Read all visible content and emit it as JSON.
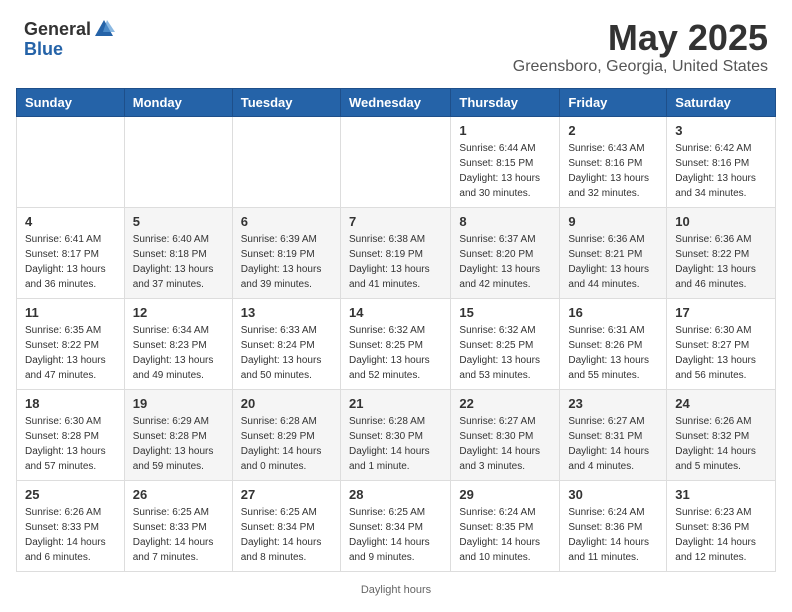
{
  "header": {
    "logo_general": "General",
    "logo_blue": "Blue",
    "title": "May 2025",
    "subtitle": "Greensboro, Georgia, United States"
  },
  "calendar": {
    "days_of_week": [
      "Sunday",
      "Monday",
      "Tuesday",
      "Wednesday",
      "Thursday",
      "Friday",
      "Saturday"
    ],
    "weeks": [
      [
        {
          "day": "",
          "info": ""
        },
        {
          "day": "",
          "info": ""
        },
        {
          "day": "",
          "info": ""
        },
        {
          "day": "",
          "info": ""
        },
        {
          "day": "1",
          "info": "Sunrise: 6:44 AM\nSunset: 8:15 PM\nDaylight: 13 hours and 30 minutes."
        },
        {
          "day": "2",
          "info": "Sunrise: 6:43 AM\nSunset: 8:16 PM\nDaylight: 13 hours and 32 minutes."
        },
        {
          "day": "3",
          "info": "Sunrise: 6:42 AM\nSunset: 8:16 PM\nDaylight: 13 hours and 34 minutes."
        }
      ],
      [
        {
          "day": "4",
          "info": "Sunrise: 6:41 AM\nSunset: 8:17 PM\nDaylight: 13 hours and 36 minutes."
        },
        {
          "day": "5",
          "info": "Sunrise: 6:40 AM\nSunset: 8:18 PM\nDaylight: 13 hours and 37 minutes."
        },
        {
          "day": "6",
          "info": "Sunrise: 6:39 AM\nSunset: 8:19 PM\nDaylight: 13 hours and 39 minutes."
        },
        {
          "day": "7",
          "info": "Sunrise: 6:38 AM\nSunset: 8:19 PM\nDaylight: 13 hours and 41 minutes."
        },
        {
          "day": "8",
          "info": "Sunrise: 6:37 AM\nSunset: 8:20 PM\nDaylight: 13 hours and 42 minutes."
        },
        {
          "day": "9",
          "info": "Sunrise: 6:36 AM\nSunset: 8:21 PM\nDaylight: 13 hours and 44 minutes."
        },
        {
          "day": "10",
          "info": "Sunrise: 6:36 AM\nSunset: 8:22 PM\nDaylight: 13 hours and 46 minutes."
        }
      ],
      [
        {
          "day": "11",
          "info": "Sunrise: 6:35 AM\nSunset: 8:22 PM\nDaylight: 13 hours and 47 minutes."
        },
        {
          "day": "12",
          "info": "Sunrise: 6:34 AM\nSunset: 8:23 PM\nDaylight: 13 hours and 49 minutes."
        },
        {
          "day": "13",
          "info": "Sunrise: 6:33 AM\nSunset: 8:24 PM\nDaylight: 13 hours and 50 minutes."
        },
        {
          "day": "14",
          "info": "Sunrise: 6:32 AM\nSunset: 8:25 PM\nDaylight: 13 hours and 52 minutes."
        },
        {
          "day": "15",
          "info": "Sunrise: 6:32 AM\nSunset: 8:25 PM\nDaylight: 13 hours and 53 minutes."
        },
        {
          "day": "16",
          "info": "Sunrise: 6:31 AM\nSunset: 8:26 PM\nDaylight: 13 hours and 55 minutes."
        },
        {
          "day": "17",
          "info": "Sunrise: 6:30 AM\nSunset: 8:27 PM\nDaylight: 13 hours and 56 minutes."
        }
      ],
      [
        {
          "day": "18",
          "info": "Sunrise: 6:30 AM\nSunset: 8:28 PM\nDaylight: 13 hours and 57 minutes."
        },
        {
          "day": "19",
          "info": "Sunrise: 6:29 AM\nSunset: 8:28 PM\nDaylight: 13 hours and 59 minutes."
        },
        {
          "day": "20",
          "info": "Sunrise: 6:28 AM\nSunset: 8:29 PM\nDaylight: 14 hours and 0 minutes."
        },
        {
          "day": "21",
          "info": "Sunrise: 6:28 AM\nSunset: 8:30 PM\nDaylight: 14 hours and 1 minute."
        },
        {
          "day": "22",
          "info": "Sunrise: 6:27 AM\nSunset: 8:30 PM\nDaylight: 14 hours and 3 minutes."
        },
        {
          "day": "23",
          "info": "Sunrise: 6:27 AM\nSunset: 8:31 PM\nDaylight: 14 hours and 4 minutes."
        },
        {
          "day": "24",
          "info": "Sunrise: 6:26 AM\nSunset: 8:32 PM\nDaylight: 14 hours and 5 minutes."
        }
      ],
      [
        {
          "day": "25",
          "info": "Sunrise: 6:26 AM\nSunset: 8:33 PM\nDaylight: 14 hours and 6 minutes."
        },
        {
          "day": "26",
          "info": "Sunrise: 6:25 AM\nSunset: 8:33 PM\nDaylight: 14 hours and 7 minutes."
        },
        {
          "day": "27",
          "info": "Sunrise: 6:25 AM\nSunset: 8:34 PM\nDaylight: 14 hours and 8 minutes."
        },
        {
          "day": "28",
          "info": "Sunrise: 6:25 AM\nSunset: 8:34 PM\nDaylight: 14 hours and 9 minutes."
        },
        {
          "day": "29",
          "info": "Sunrise: 6:24 AM\nSunset: 8:35 PM\nDaylight: 14 hours and 10 minutes."
        },
        {
          "day": "30",
          "info": "Sunrise: 6:24 AM\nSunset: 8:36 PM\nDaylight: 14 hours and 11 minutes."
        },
        {
          "day": "31",
          "info": "Sunrise: 6:23 AM\nSunset: 8:36 PM\nDaylight: 14 hours and 12 minutes."
        }
      ]
    ]
  },
  "footer": {
    "note": "Daylight hours"
  }
}
